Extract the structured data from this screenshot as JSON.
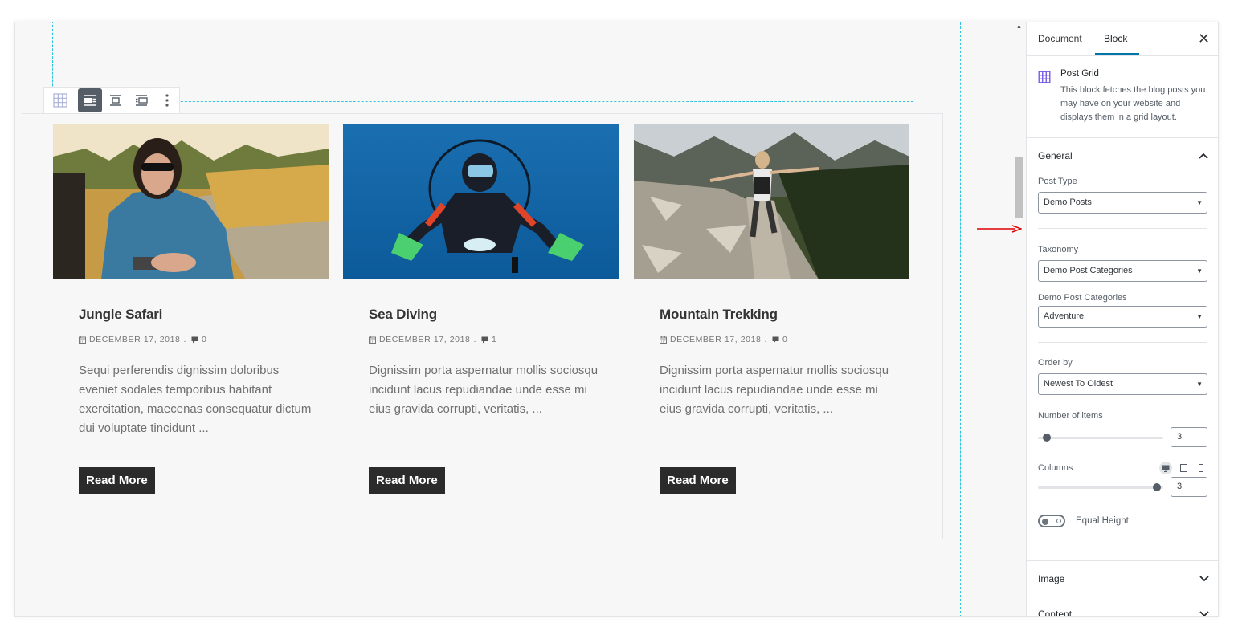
{
  "toolbar": {
    "buttons": [
      "block-type",
      "align-wide",
      "align-center",
      "align-full",
      "more-options"
    ]
  },
  "posts": [
    {
      "title": "Jungle Safari",
      "date": "DECEMBER 17, 2018",
      "separator": ".",
      "comments": "0",
      "excerpt": "Sequi perferendis dignissim doloribus eveniet sodales temporibus habitant exercitation, maecenas consequatur dictum dui voluptate tincidunt ...",
      "button": "Read More"
    },
    {
      "title": "Sea Diving",
      "date": "DECEMBER 17, 2018",
      "separator": ".",
      "comments": "1",
      "excerpt": "Dignissim porta aspernatur mollis sociosqu incidunt lacus repudiandae unde esse mi eius gravida corrupti, veritatis, ...",
      "button": "Read More"
    },
    {
      "title": "Mountain Trekking",
      "date": "DECEMBER 17, 2018",
      "separator": ".",
      "comments": "0",
      "excerpt": "Dignissim porta aspernatur mollis sociosqu incidunt lacus repudiandae unde esse mi eius gravida corrupti, veritatis, ...",
      "button": "Read More"
    }
  ],
  "sidebar": {
    "tabs": [
      "Document",
      "Block"
    ],
    "active_tab": "Block",
    "close": "✕",
    "block": {
      "title": "Post Grid",
      "description": "This block fetches the blog posts you may have on your website and displays them in a grid layout."
    },
    "general": {
      "title": "General",
      "post_type_label": "Post Type",
      "post_type_value": "Demo Posts",
      "taxonomy_label": "Taxonomy",
      "taxonomy_value": "Demo Post Categories",
      "categories_label": "Demo Post Categories",
      "categories_value": "Adventure",
      "order_label": "Order by",
      "order_value": "Newest To Oldest",
      "items_label": "Number of items",
      "items_value": "3",
      "columns_label": "Columns",
      "columns_value": "3",
      "equal_height_label": "Equal Height",
      "equal_height_on": false
    },
    "panels": [
      "Image",
      "Content"
    ]
  },
  "colors": {
    "accent": "#0073aa",
    "button_bg": "#2b2b2b",
    "dashed_outline": "#2bc5e0",
    "arrow": "#e00000",
    "block_icon": "#6b4fe0"
  }
}
